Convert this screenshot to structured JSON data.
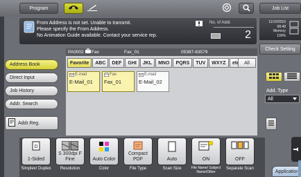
{
  "topbar": {
    "program": "Program",
    "job_list": "Job List",
    "fax_icon": "fax-handset-icon",
    "scan_icon": "scan-tray-icon",
    "counter_icon": "counter-meter-icon",
    "search_icon": "search-icon"
  },
  "message": {
    "lines": [
      "From Address is not set. Unable to transmit.",
      "Please specify the From Address.",
      "No Animation Guide available. Contact your service rep."
    ],
    "addr_count_label": "No. of Addr.",
    "addr_count": "2"
  },
  "status": {
    "date": "11/10/2016",
    "time": "08:48",
    "memory_label": "Memory",
    "memory_value": "100%"
  },
  "check_setting": "Check Setting",
  "tx_strip": {
    "sender": "PA0002",
    "mode": "Fax",
    "name": "Fax_01",
    "number": "05387-63579"
  },
  "nav": {
    "address_book": "Address Book",
    "direct_input": "Direct Input",
    "job_history": "Job History",
    "addr_search": "Addr. Search",
    "addr_reg": "Addr.Reg."
  },
  "index_tabs": [
    "Favorite",
    "ABC",
    "DEF",
    "GHI",
    "JKL",
    "MNO",
    "PQRS",
    "TUV",
    "WXYZ",
    "etc"
  ],
  "all_label": "All",
  "destinations": [
    {
      "type": "E-mail",
      "name": "E-Mail_01",
      "selected": true
    },
    {
      "type": "Fax",
      "name": "Fax_01",
      "selected": true
    },
    {
      "type": "E-mail",
      "name": "E-Mail_02",
      "selected": false
    }
  ],
  "add_type": {
    "label": "Add. Type",
    "value": "All"
  },
  "settings": [
    {
      "value": "1-Sided",
      "label": "Simplex/ Duplex"
    },
    {
      "value": "S 300dpi F Fine",
      "label": "Resolution"
    },
    {
      "value": "Auto Color",
      "label": "Color"
    },
    {
      "value": "Compact PDF",
      "label": "File Type"
    },
    {
      "value": "Auto",
      "label": "Scan Size"
    },
    {
      "value": "ON",
      "label": "File Name/ Subject Name/Other"
    },
    {
      "value": "OFF",
      "label": "Separate Scan"
    }
  ],
  "application": "Application",
  "colors": {
    "accent_yellow": "#d8d23a",
    "panel_dark": "#2c2e33",
    "background": "#6d6f76"
  }
}
